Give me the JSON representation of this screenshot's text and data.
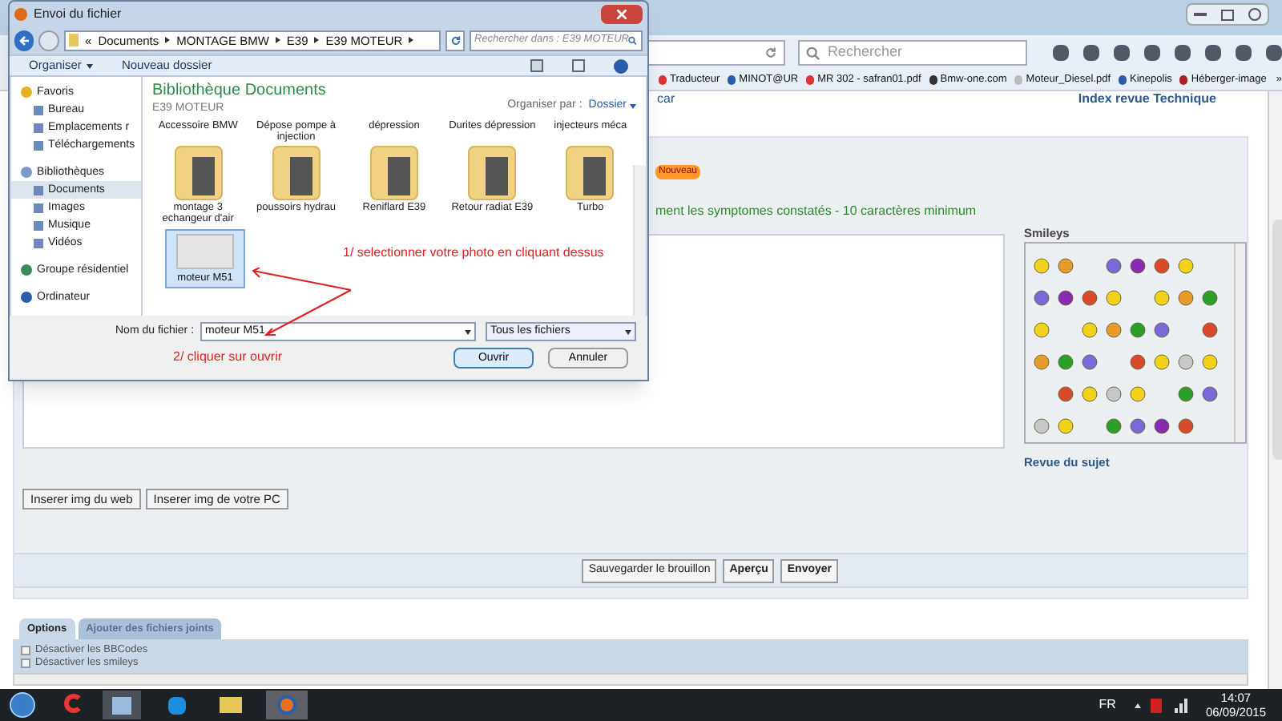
{
  "browser": {
    "search_placeholder": "Rechercher",
    "bookmarks": [
      "Traducteur",
      "MINOT@UR",
      "MR 302 - safran01.pdf",
      "Bmw-one.com",
      "Moteur_Diesel.pdf",
      "Kinepolis",
      "Héberger-image"
    ],
    "more_bookmarks": "»"
  },
  "page": {
    "top_left_text": "car",
    "top_right_link": "Index revue Technique",
    "new_badge": "Nouveau",
    "hint": "ment les symptomes constatés - 10 caractères minimum",
    "smileys_title": "Smileys",
    "review_link": "Revue du sujet",
    "image_buttons": [
      "Inserer img du web",
      "Inserer img de votre PC"
    ],
    "submit_buttons": [
      {
        "label": "Sauvegarder le brouillon",
        "bold": false
      },
      {
        "label": "Aperçu",
        "bold": true
      },
      {
        "label": "Envoyer",
        "bold": true
      }
    ],
    "tabs": [
      {
        "label": "Options",
        "selected": true
      },
      {
        "label": "Ajouter des fichiers joints",
        "selected": false
      }
    ],
    "options": [
      {
        "label": "Désactiver les BBCodes",
        "checked": false
      },
      {
        "label": "Désactiver les smileys",
        "checked": false
      }
    ]
  },
  "dialog": {
    "title": "Envoi du fichier",
    "breadcrumb_prefix": "«",
    "breadcrumb": [
      "Documents",
      "MONTAGE BMW",
      "E39",
      "E39 MOTEUR"
    ],
    "search_placeholder": "Rechercher dans : E39 MOTEUR",
    "toolbar": [
      "Organiser",
      "Nouveau dossier"
    ],
    "sidebar": [
      {
        "label": "Favoris",
        "selected": false,
        "children": [
          {
            "label": "Bureau",
            "selected": false
          },
          {
            "label": "Emplacements r",
            "selected": false
          },
          {
            "label": "Téléchargements",
            "selected": false
          }
        ]
      },
      {
        "label": "Bibliothèques",
        "selected": false,
        "children": [
          {
            "label": "Documents",
            "selected": true
          },
          {
            "label": "Images",
            "selected": false
          },
          {
            "label": "Musique",
            "selected": false
          },
          {
            "label": "Vidéos",
            "selected": false
          }
        ]
      },
      {
        "label": "Groupe résidentiel",
        "selected": false
      },
      {
        "label": "Ordinateur",
        "selected": false
      }
    ],
    "library_title": "Bibliothèque Documents",
    "library_subtitle": "E39 MOTEUR",
    "arrange_label": "Organiser par :",
    "arrange_value": "Dossier",
    "top_labels": [
      "Accessoire BMW",
      "Dépose pompe à injection",
      "dépression",
      "Durites dépression",
      "injecteurs méca"
    ],
    "folders": [
      {
        "label": "montage 3 echangeur d'air"
      },
      {
        "label": "poussoirs hydrau"
      },
      {
        "label": "Reniflard E39"
      },
      {
        "label": "Retour radiat E39"
      },
      {
        "label": "Turbo"
      }
    ],
    "files": [
      {
        "label": "moteur M51",
        "selected": true
      }
    ],
    "filename_label": "Nom du fichier :",
    "filename_value": "moteur M51",
    "filetype": "Tous les fichiers",
    "buttons": [
      "Ouvrir",
      "Annuler"
    ],
    "annotations": [
      "1/  selectionner votre photo en cliquant dessus",
      "2/ cliquer sur ouvrir"
    ]
  },
  "taskbar": {
    "language": "FR",
    "time": "14:07",
    "date": "06/09/2015"
  }
}
